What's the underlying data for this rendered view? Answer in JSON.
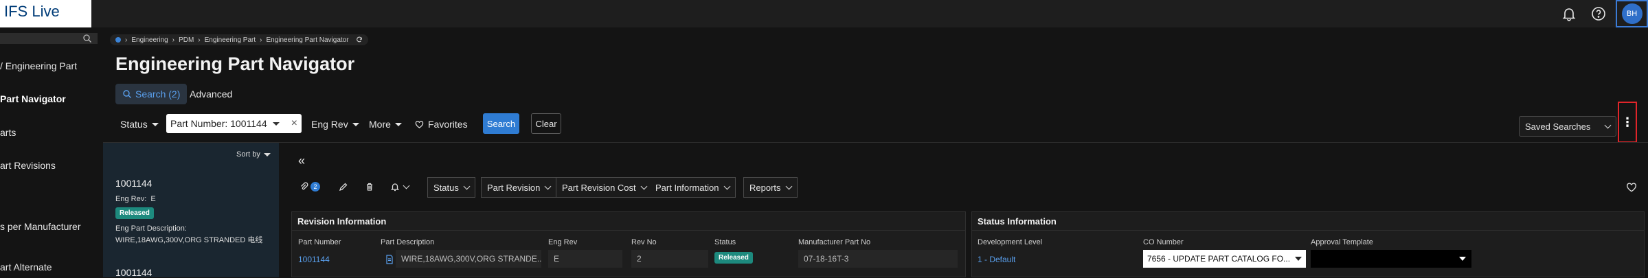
{
  "app": {
    "title": "IFS Live",
    "user_initials": "BH"
  },
  "sidebar": {
    "items": [
      {
        "label": "/ Engineering Part"
      },
      {
        "label": "Part Navigator",
        "active": true
      },
      {
        "label": "arts"
      },
      {
        "label": "art Revisions"
      },
      {
        "label": "s per Manufacturer"
      },
      {
        "label": "art Alternate"
      }
    ]
  },
  "breadcrumb": [
    "Engineering",
    "PDM",
    "Engineering Part",
    "Engineering Part Navigator"
  ],
  "page": {
    "title": "Engineering Part Navigator"
  },
  "search_tabs": {
    "search": "Search (2)",
    "advanced": "Advanced"
  },
  "filters": {
    "status": "Status",
    "part_number": "Part Number: 1001144",
    "eng_rev": "Eng Rev",
    "more": "More",
    "favorites": "Favorites",
    "search_button": "Search",
    "clear_button": "Clear",
    "saved_searches": "Saved Searches"
  },
  "list": {
    "sort_by": "Sort by",
    "items": [
      {
        "number": "1001144",
        "eng_rev_label": "Eng Rev:",
        "eng_rev": "E",
        "status": "Released",
        "desc_label": "Eng Part Description:",
        "description": "WIRE,18AWG,300V,ORG STRANDED 电线"
      },
      {
        "number": "1001144"
      }
    ]
  },
  "toolbar": {
    "attachment_count": "2",
    "commands": [
      "Status",
      "Part Revision",
      "Part Revision Cost",
      "Part Information",
      "Reports"
    ]
  },
  "revision_info": {
    "title": "Revision Information",
    "fields": {
      "part_number": {
        "label": "Part Number",
        "value": "1001144"
      },
      "part_description": {
        "label": "Part Description",
        "value": "WIRE,18AWG,300V,ORG STRANDE..."
      },
      "eng_rev": {
        "label": "Eng Rev",
        "value": "E"
      },
      "rev_no": {
        "label": "Rev No",
        "value": "2"
      },
      "status": {
        "label": "Status",
        "value": "Released"
      },
      "manufacturer_part_no": {
        "label": "Manufacturer Part No",
        "value": "07-18-16T-3"
      }
    }
  },
  "status_info": {
    "title": "Status Information",
    "fields": {
      "development_level": {
        "label": "Development Level",
        "value": "1 - Default"
      },
      "co_number": {
        "label": "CO Number",
        "value": "7656 - UPDATE PART CATALOG FO..."
      },
      "approval_template": {
        "label": "Approval Template",
        "value": ""
      }
    }
  },
  "colors": {
    "accent": "#2f7cd3",
    "released": "#1d8a7e",
    "highlight": "#e0252a",
    "list_bg": "#1a2630"
  }
}
